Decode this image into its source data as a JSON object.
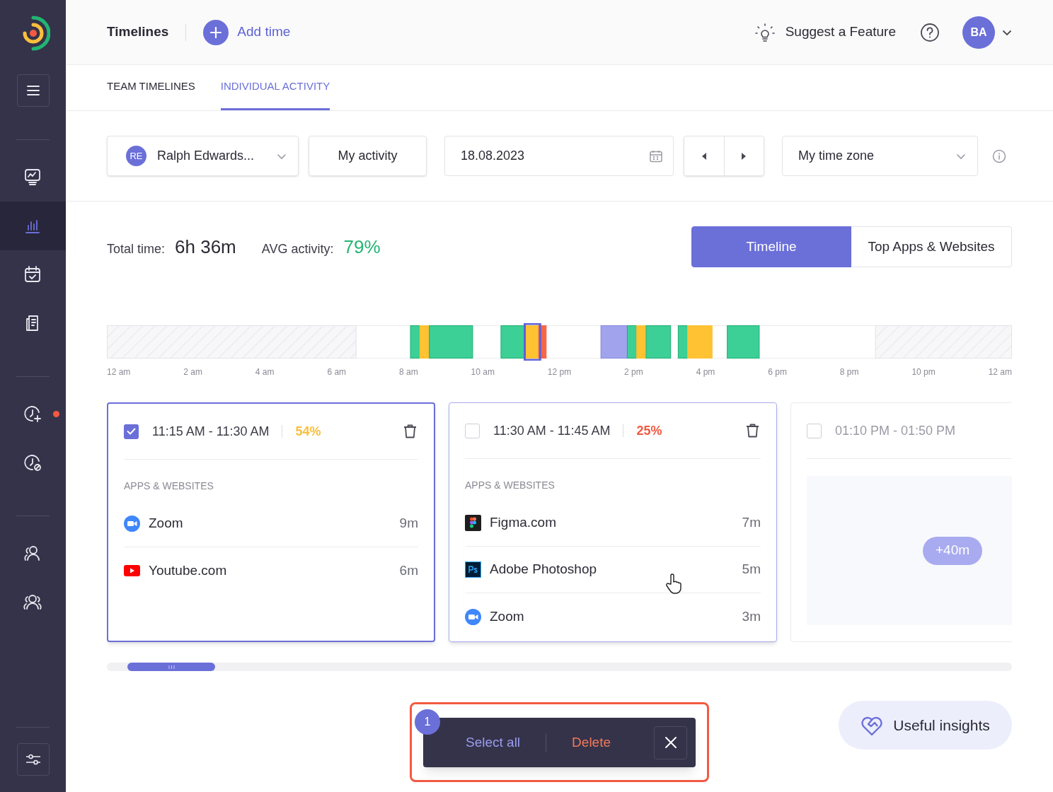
{
  "sidebar": {
    "items": [
      {
        "kind": "dashboard",
        "selected": false
      },
      {
        "kind": "reports",
        "selected": true
      },
      {
        "kind": "calendar",
        "selected": false
      },
      {
        "kind": "documents",
        "selected": false
      },
      {
        "kind": "addtime",
        "selected": false,
        "badge": true
      },
      {
        "kind": "blocked",
        "selected": false
      },
      {
        "kind": "member",
        "selected": false
      },
      {
        "kind": "team",
        "selected": false
      }
    ]
  },
  "header": {
    "title": "Timelines",
    "add_button": "Add time",
    "suggest": "Suggest a Feature",
    "avatar": "BA"
  },
  "tabs": [
    {
      "label": "TEAM TIMELINES",
      "selected": false
    },
    {
      "label": "INDIVIDUAL ACTIVITY",
      "selected": true
    }
  ],
  "filters": {
    "user_initials": "RE",
    "user_name": "Ralph Edwards...",
    "activity": "My activity",
    "date": "18.08.2023",
    "timezone": "My time zone"
  },
  "stats": {
    "total_label": "Total time:",
    "total": "6h 36m",
    "avg_label": "AVG activity:",
    "avg": "79%"
  },
  "views": [
    {
      "label": "Timeline",
      "selected": true
    },
    {
      "label": "Top Apps & Websites",
      "selected": false
    }
  ],
  "timeline": {
    "ticks": [
      "12 am",
      "2 am",
      "4 am",
      "6 am",
      "8 am",
      "10 am",
      "12 pm",
      "2 pm",
      "4 pm",
      "6 pm",
      "8 pm",
      "10 pm",
      "12 am"
    ]
  },
  "cards": [
    {
      "kind": "apps",
      "time": "11:15 AM - 11:30 AM",
      "percent": "54%",
      "color": "#fbbf3c",
      "checked": true,
      "selected": true,
      "hovered": false,
      "heading": "APPS & WEBSITES",
      "apps": [
        {
          "kind": "zoom",
          "name": "Zoom",
          "duration": "9m"
        },
        {
          "kind": "youtube",
          "name": "Youtube.com",
          "duration": "6m"
        }
      ]
    },
    {
      "kind": "apps",
      "time": "11:30 AM - 11:45 AM",
      "percent": "25%",
      "color": "#f25a41",
      "checked": false,
      "selected": false,
      "hovered": true,
      "heading": "APPS & WEBSITES",
      "apps": [
        {
          "kind": "figma",
          "name": "Figma.com",
          "duration": "7m"
        },
        {
          "kind": "photoshop",
          "name": "Adobe Photoshop",
          "duration": "5m"
        },
        {
          "kind": "zoom",
          "name": "Zoom",
          "duration": "3m"
        }
      ]
    },
    {
      "kind": "pending",
      "time": "01:10 PM - 01:50 PM",
      "checked": false,
      "selected": false,
      "hovered": false,
      "extra": "+40m"
    }
  ],
  "selection_bar": {
    "count": "1",
    "select_all": "Select all",
    "delete": "Delete"
  },
  "insights_button": "Useful insights"
}
